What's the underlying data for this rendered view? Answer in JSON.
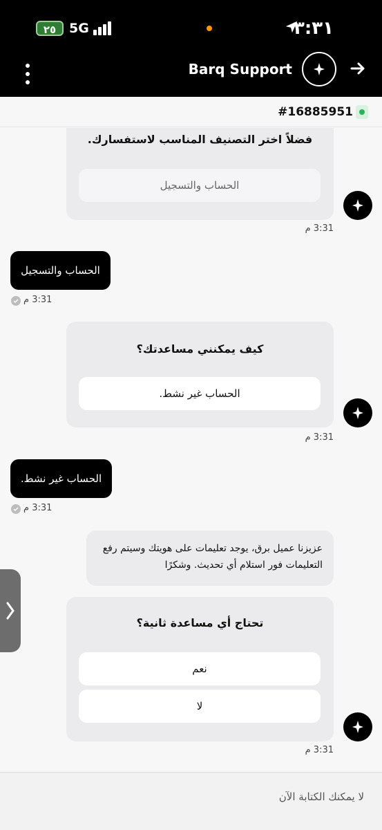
{
  "status_bar": {
    "time": "٣:٣١",
    "battery": "٢٥",
    "network": "5G"
  },
  "header": {
    "title": "Barq Support"
  },
  "ticket": {
    "number": "#16885951"
  },
  "chat": {
    "block1": {
      "title": "فضلاً اختر التصنيف المناسب لاستفسارك.",
      "option": "الحساب والتسجيل",
      "time": "3:31 م"
    },
    "user1": {
      "text": "الحساب والتسجيل",
      "time": "3:31 م"
    },
    "block2": {
      "title": "كيف يمكنني مساعدتك؟",
      "option": "الحساب غير نشط.",
      "time": "3:31 م"
    },
    "user2": {
      "text": "الحساب غير نشط.",
      "time": "3:31 م"
    },
    "bot_message": "عزيزنا عميل برق، يوجد تعليمات على هويتك وسيتم رفع التعليمات فور استلام أي تحديث. وشكرًا",
    "block3": {
      "title": "تحتاج أي مساعدة ثانية؟",
      "option_yes": "نعم",
      "option_no": "لا",
      "time": "3:31 م"
    }
  },
  "footer": {
    "text": "لا يمكنك الكتابة الآن"
  },
  "colors": {
    "header_bg": "#000000",
    "online_dot": "#2bb25a",
    "card_bg": "#ebebed",
    "user_bubble": "#000000"
  },
  "icons": [
    "location-arrow-icon",
    "battery-icon",
    "signal-icon",
    "more-vertical-icon",
    "barq-logo-icon",
    "arrow-right-icon",
    "read-check-icon",
    "chevron-right-icon"
  ]
}
